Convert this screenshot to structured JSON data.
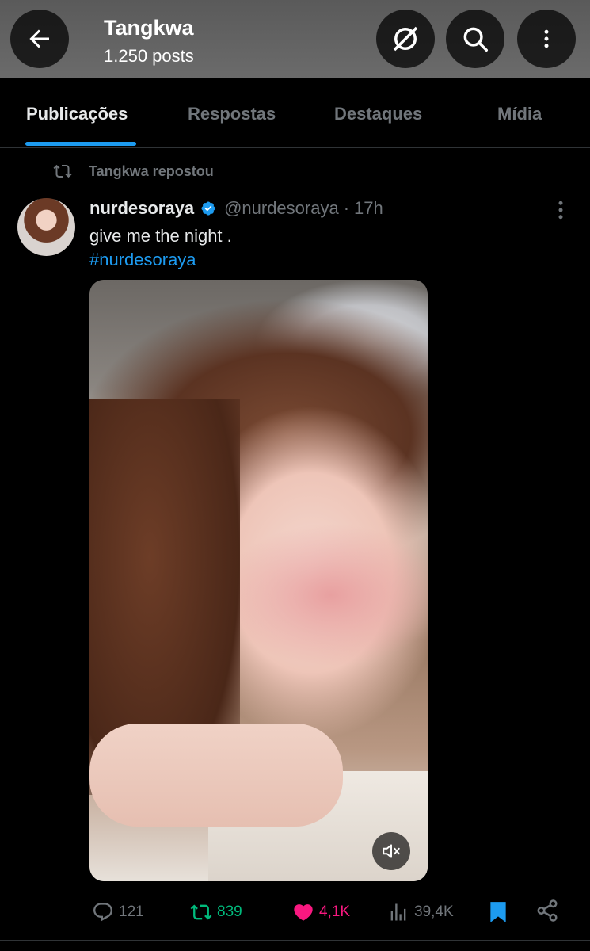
{
  "header": {
    "title": "Tangkwa",
    "subtitle": "1.250 posts"
  },
  "tabs": [
    {
      "label": "Publicações",
      "active": true
    },
    {
      "label": "Respostas",
      "active": false
    },
    {
      "label": "Destaques",
      "active": false
    },
    {
      "label": "Mídia",
      "active": false
    }
  ],
  "post": {
    "repost_label": "Tangkwa repostou",
    "author_name": "nurdesoraya",
    "handle": "@nurdesoraya",
    "separator": "·",
    "time": "17h",
    "text": "give me the night .",
    "hashtag": "#nurdesoraya",
    "media_type": "video",
    "muted": true
  },
  "actions": {
    "replies": "121",
    "reposts": "839",
    "likes": "4,1K",
    "views": "39,4K",
    "bookmarked": true
  },
  "colors": {
    "accent": "#1d9bf0",
    "repost": "#00ba7c",
    "like": "#f91880",
    "muted_text": "#71767b"
  },
  "icons": [
    "back-arrow-icon",
    "incognito-icon",
    "search-icon",
    "more-vertical-icon",
    "repost-icon",
    "verified-icon",
    "reply-icon",
    "heart-icon",
    "views-icon",
    "bookmark-icon",
    "share-icon",
    "mute-icon"
  ]
}
